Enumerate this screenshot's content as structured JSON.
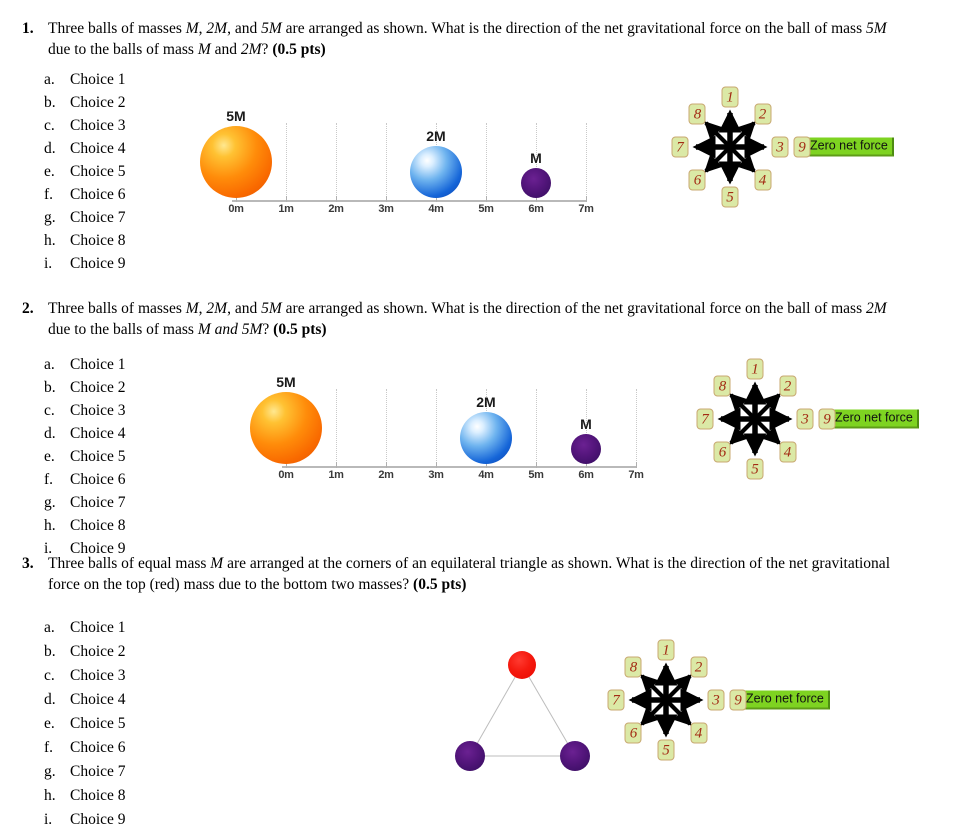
{
  "document": {
    "type": "physics-homework-multiple-choice"
  },
  "compass": {
    "directions": [
      {
        "id": "1",
        "label": "1",
        "angle_deg": 90,
        "name": "north"
      },
      {
        "id": "2",
        "label": "2",
        "angle_deg": 45,
        "name": "northeast"
      },
      {
        "id": "3",
        "label": "3",
        "angle_deg": 0,
        "name": "east"
      },
      {
        "id": "4",
        "label": "4",
        "angle_deg": -45,
        "name": "southeast"
      },
      {
        "id": "5",
        "label": "5",
        "angle_deg": -90,
        "name": "south"
      },
      {
        "id": "6",
        "label": "6",
        "angle_deg": -135,
        "name": "southwest"
      },
      {
        "id": "7",
        "label": "7",
        "angle_deg": 180,
        "name": "west"
      },
      {
        "id": "8",
        "label": "8",
        "angle_deg": 135,
        "name": "northwest"
      }
    ],
    "zero_option": {
      "label": "9",
      "text": "Zero net force"
    },
    "colors": {
      "badge_fill": "#dbe9a6",
      "badge_border": "#c8a870",
      "badge_text": "#a32b14",
      "highlight": "#7ed321",
      "arrow": "#000000"
    }
  },
  "ruler_figure": {
    "axis_min_m": 0,
    "axis_max_m": 7,
    "ticks": [
      "0m",
      "1m",
      "2m",
      "3m",
      "4m",
      "5m",
      "6m",
      "7m"
    ],
    "balls": [
      {
        "caption": "5M",
        "position_m": 0,
        "color": "#ff8c0a",
        "radius_px": 36,
        "style": "orange"
      },
      {
        "caption": "2M",
        "position_m": 4,
        "color": "#1565d8",
        "radius_px": 26,
        "style": "blue"
      },
      {
        "caption": "M",
        "position_m": 6,
        "color": "#55167d",
        "radius_px": 15,
        "style": "purple"
      }
    ]
  },
  "triangle_figure": {
    "shape": "equilateral-triangle",
    "balls": [
      {
        "vertex": "top",
        "color": "#f51a0f",
        "style": "red",
        "radius_px": 14
      },
      {
        "vertex": "bottom-left",
        "color": "#55167d",
        "style": "purple",
        "radius_px": 15
      },
      {
        "vertex": "bottom-right",
        "color": "#55167d",
        "style": "purple",
        "radius_px": 15
      }
    ],
    "edge_color": "#bdbdbd"
  },
  "choices": [
    {
      "letter": "a.",
      "label": "Choice 1"
    },
    {
      "letter": "b.",
      "label": "Choice 2"
    },
    {
      "letter": "c.",
      "label": "Choice 3"
    },
    {
      "letter": "d.",
      "label": "Choice 4"
    },
    {
      "letter": "e.",
      "label": "Choice 5"
    },
    {
      "letter": "f.",
      "label": "Choice 6"
    },
    {
      "letter": "g.",
      "label": "Choice 7"
    },
    {
      "letter": "h.",
      "label": "Choice 8"
    },
    {
      "letter": "i.",
      "label": "Choice 9"
    }
  ],
  "questions": [
    {
      "number": "1.",
      "text_parts": [
        {
          "t": "Three balls of masses ",
          "style": "normal"
        },
        {
          "t": "M",
          "style": "italic"
        },
        {
          "t": ", ",
          "style": "normal"
        },
        {
          "t": "2M",
          "style": "italic"
        },
        {
          "t": ", and ",
          "style": "normal"
        },
        {
          "t": "5M",
          "style": "italic"
        },
        {
          "t": " are arranged as shown. What is the direction of the net gravitational force on the ball of mass ",
          "style": "normal"
        },
        {
          "t": "5M",
          "style": "italic"
        },
        {
          "t": " due to the balls of mass ",
          "style": "normal"
        },
        {
          "t": "M",
          "style": "italic"
        },
        {
          "t": " and ",
          "style": "normal"
        },
        {
          "t": "2M",
          "style": "italic"
        },
        {
          "t": "? ",
          "style": "normal"
        },
        {
          "t": "(0.5 pts)",
          "style": "bold"
        }
      ],
      "points": "0.5 pts",
      "figure": "ruler"
    },
    {
      "number": "2.",
      "text_parts": [
        {
          "t": "Three balls of masses ",
          "style": "normal"
        },
        {
          "t": "M",
          "style": "italic"
        },
        {
          "t": ", ",
          "style": "normal"
        },
        {
          "t": "2M",
          "style": "italic"
        },
        {
          "t": ", and ",
          "style": "normal"
        },
        {
          "t": "5M",
          "style": "italic"
        },
        {
          "t": " are arranged as shown. What is the direction of the net gravitational force on the ball of mass ",
          "style": "normal"
        },
        {
          "t": "2M",
          "style": "italic"
        },
        {
          "t": " due to the balls of mass ",
          "style": "normal"
        },
        {
          "t": "M and 5M",
          "style": "italic"
        },
        {
          "t": "? ",
          "style": "normal"
        },
        {
          "t": "(0.5 pts)",
          "style": "bold"
        }
      ],
      "points": "0.5 pts",
      "figure": "ruler"
    },
    {
      "number": "3.",
      "text_parts": [
        {
          "t": "Three balls of equal mass ",
          "style": "normal"
        },
        {
          "t": "M",
          "style": "italic"
        },
        {
          "t": " are arranged at the corners of an equilateral triangle as shown. What is the direction of the net gravitational force on the top (red) mass due to the bottom two masses? ",
          "style": "normal"
        },
        {
          "t": "(0.5 pts)",
          "style": "bold"
        }
      ],
      "points": "0.5 pts",
      "figure": "triangle"
    }
  ]
}
